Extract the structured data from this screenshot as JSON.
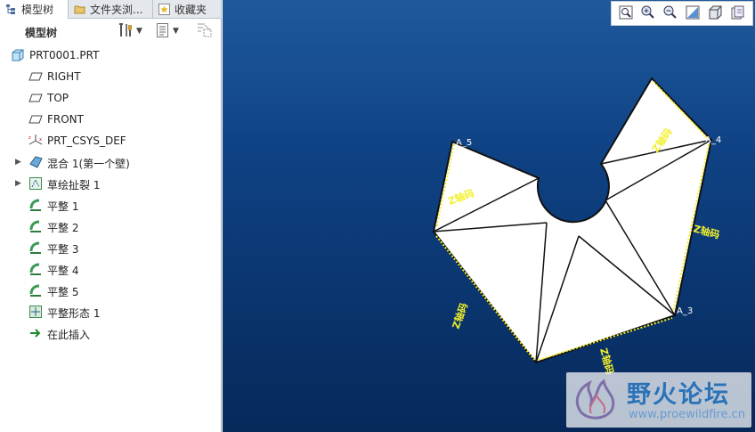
{
  "tabs": [
    {
      "label": "模型树",
      "icon": "tree-icon"
    },
    {
      "label": "文件夹浏...",
      "icon": "folder-icon"
    },
    {
      "label": "收藏夹",
      "icon": "favorites-icon"
    }
  ],
  "panel": {
    "title": "模型树"
  },
  "tree": [
    {
      "label": "PRT0001.PRT",
      "icon": "part-icon",
      "expandable": false
    },
    {
      "label": "RIGHT",
      "icon": "datum-plane-icon",
      "expandable": false
    },
    {
      "label": "TOP",
      "icon": "datum-plane-icon",
      "expandable": false
    },
    {
      "label": "FRONT",
      "icon": "datum-plane-icon",
      "expandable": false
    },
    {
      "label": "PRT_CSYS_DEF",
      "icon": "csys-icon",
      "expandable": false
    },
    {
      "label": "混合 1(第一个壁)",
      "icon": "blend-wall-icon",
      "expandable": true
    },
    {
      "label": "草绘扯裂 1",
      "icon": "sketch-rip-icon",
      "expandable": true
    },
    {
      "label": "平整 1",
      "icon": "flatten-icon",
      "expandable": false
    },
    {
      "label": "平整 2",
      "icon": "flatten-icon",
      "expandable": false
    },
    {
      "label": "平整 3",
      "icon": "flatten-icon",
      "expandable": false
    },
    {
      "label": "平整 4",
      "icon": "flatten-icon",
      "expandable": false
    },
    {
      "label": "平整 5",
      "icon": "flatten-icon",
      "expandable": false
    },
    {
      "label": "平整形态 1",
      "icon": "flat-pattern-icon",
      "expandable": false
    },
    {
      "label": "在此插入",
      "icon": "insert-here-icon",
      "expandable": false
    }
  ],
  "view_toolbar": [
    "refit-icon",
    "zoom-in-icon",
    "zoom-out-icon",
    "repaint-icon",
    "shaded-view-icon",
    "saved-views-icon"
  ],
  "model_labels": {
    "vertex_labels": [
      "A_5",
      "A_4",
      "A_3"
    ],
    "edge_labels": [
      "Z轴码",
      "Z轴码",
      "Z轴码",
      "Z轴码",
      "Z轴码"
    ]
  },
  "watermark": {
    "text": "野火论坛",
    "url": "www.proewildfire.cn"
  },
  "colors": {
    "accent_yellow": "#f2ef2a",
    "view_bg": "#0f4284"
  }
}
